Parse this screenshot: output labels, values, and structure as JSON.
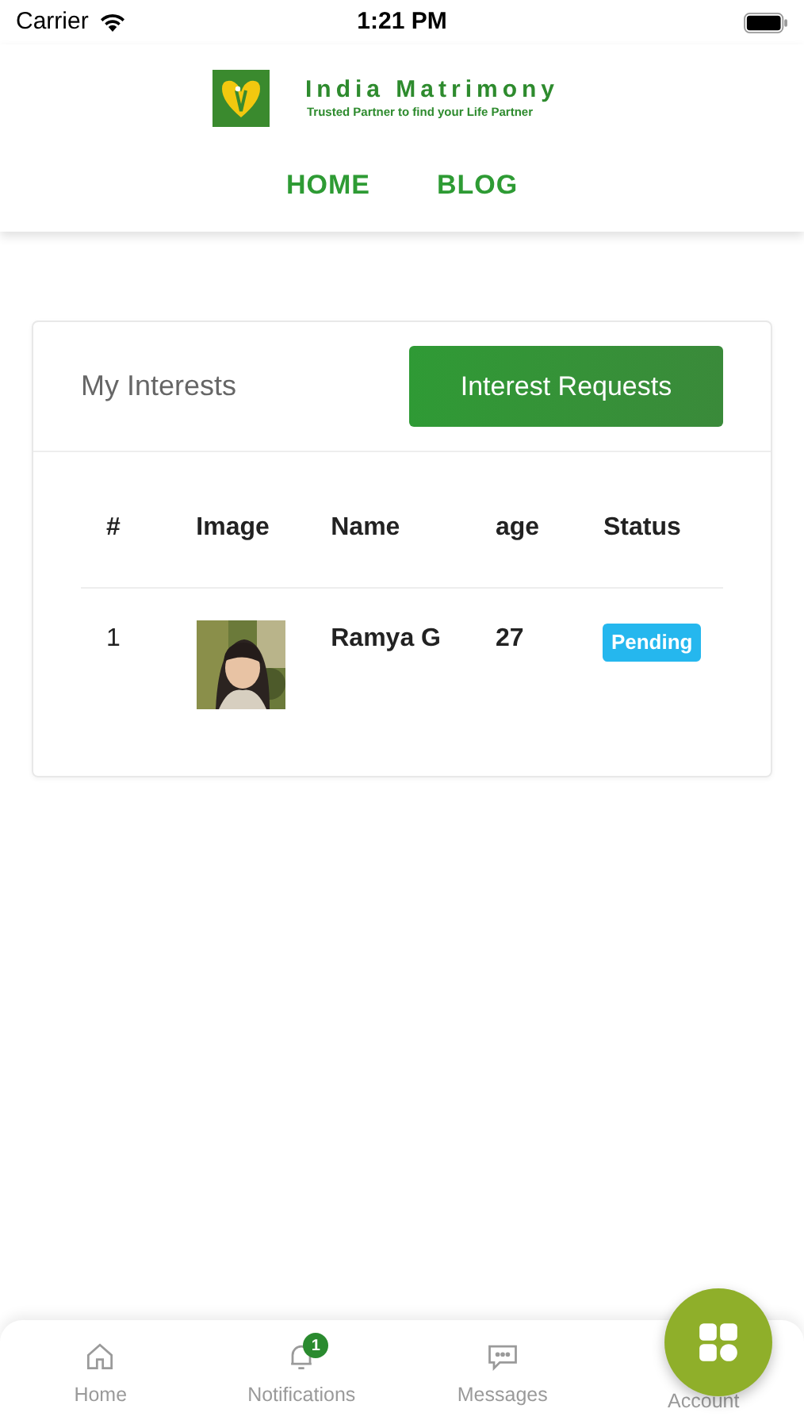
{
  "status_bar": {
    "carrier": "Carrier",
    "time": "1:21 PM"
  },
  "header": {
    "brand": "India Matrimony",
    "tagline": "Trusted Partner to find your Life Partner",
    "nav": [
      {
        "label": "HOME"
      },
      {
        "label": "BLOG"
      }
    ]
  },
  "card": {
    "title": "My Interests",
    "button": "Interest Requests",
    "table": {
      "columns": [
        "#",
        "Image",
        "Name",
        "age",
        "Status"
      ],
      "rows": [
        {
          "number": "1",
          "name": "Ramya G",
          "age": "27",
          "status": "Pending"
        }
      ]
    }
  },
  "tab_bar": {
    "items": [
      {
        "kind": "home",
        "label": "Home"
      },
      {
        "kind": "notifications",
        "label": "Notifications",
        "badge": "1"
      },
      {
        "kind": "messages",
        "label": "Messages"
      },
      {
        "kind": "account",
        "label": "Account"
      }
    ]
  }
}
